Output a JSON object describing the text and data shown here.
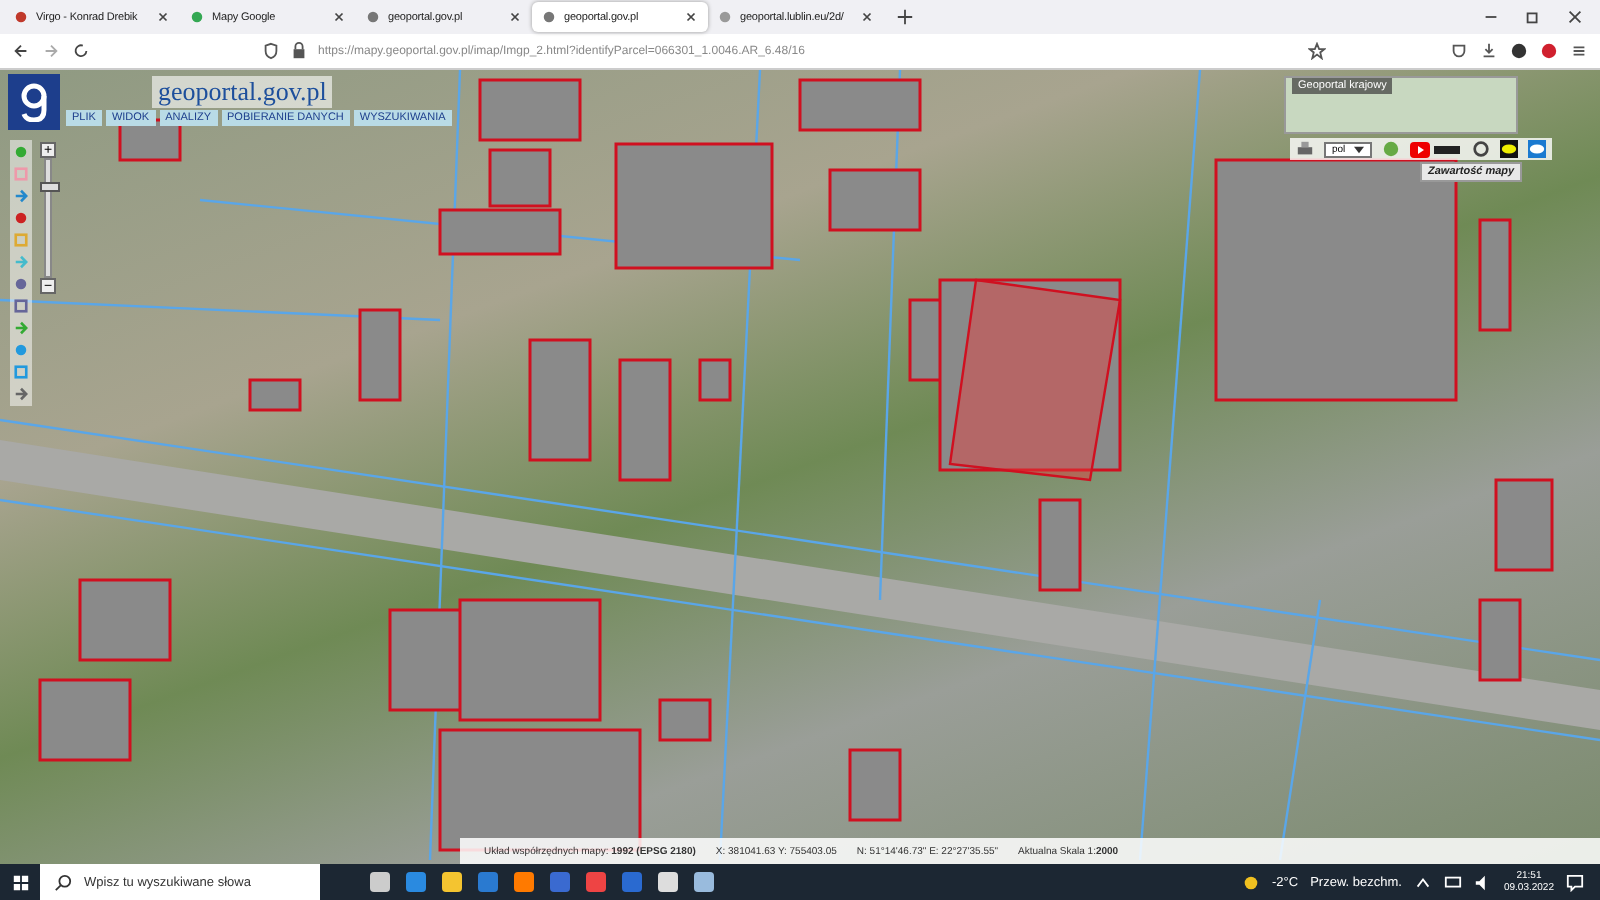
{
  "tabs": [
    {
      "label": "Virgo - Konrad Drebik",
      "selected": false
    },
    {
      "label": "Mapy Google",
      "selected": false
    },
    {
      "label": "geoportal.gov.pl",
      "selected": false
    },
    {
      "label": "geoportal.gov.pl",
      "selected": true
    },
    {
      "label": "geoportal.lublin.eu/2d/",
      "selected": false
    }
  ],
  "address_bar": {
    "url": "https://mapy.geoportal.gov.pl/imap/Imgp_2.html?identifyParcel=066301_1.0046.AR_6.48/16"
  },
  "map": {
    "logo": "geoportal.gov.pl",
    "menu": [
      "PLIK",
      "WIDOK",
      "ANALIZY",
      "POBIERANIE DANYCH",
      "WYSZUKIWANIA"
    ],
    "zoom": {
      "plus": "+",
      "minus": "−",
      "level": 0.8
    },
    "overview": {
      "title": "Geoportal krajowy",
      "language": "pol",
      "map_contents": "Zawartość mapy"
    },
    "status": [
      "Układ współrzędnych mapy: **1992 (EPSG 2180)**",
      "X: 381041.63 Y: 755403.05",
      "N: 51°14'46.73\" E: 22°27'35.55\"",
      "Aktualna Skala 1:**2000**"
    ]
  },
  "taskbar": {
    "search_placeholder": "Wpisz tu wyszukiwane słowa",
    "temperature": "-2°C",
    "weather": "Przew. bezchm.",
    "time": "21:51",
    "date": "09.03.2022"
  }
}
